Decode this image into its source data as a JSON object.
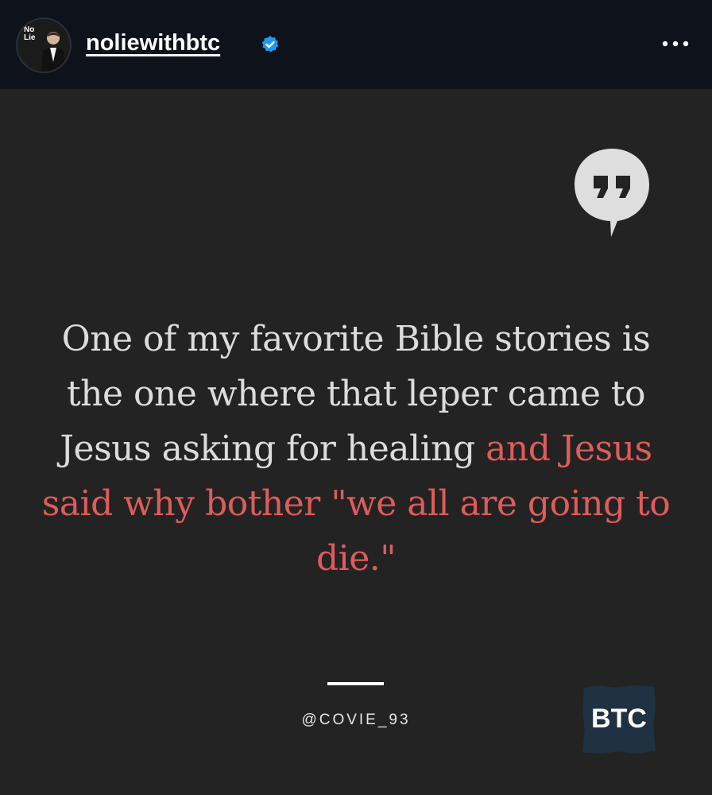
{
  "header": {
    "username": "noliewithbtc",
    "avatar_logo_line1": "No",
    "avatar_logo_line2": "Lie",
    "verified_icon": "verified-badge-icon",
    "more_icon": "more-options-icon"
  },
  "post": {
    "quote_icon": "quote-bubble-icon",
    "quote_plain": "One of my favorite Bible stories is the one where that leper came to Jesus asking for healing ",
    "quote_highlight": "and Jesus said why bother \"we all are going to die.\"",
    "handle": "@COVIE_93",
    "brand_logo": "BTC"
  },
  "colors": {
    "header_bg": "#0d121b",
    "post_bg": "#232323",
    "text": "#dcdcdc",
    "highlight": "#e05b5b",
    "verified": "#1d9bf0",
    "logo_bg": "#1f3142"
  }
}
